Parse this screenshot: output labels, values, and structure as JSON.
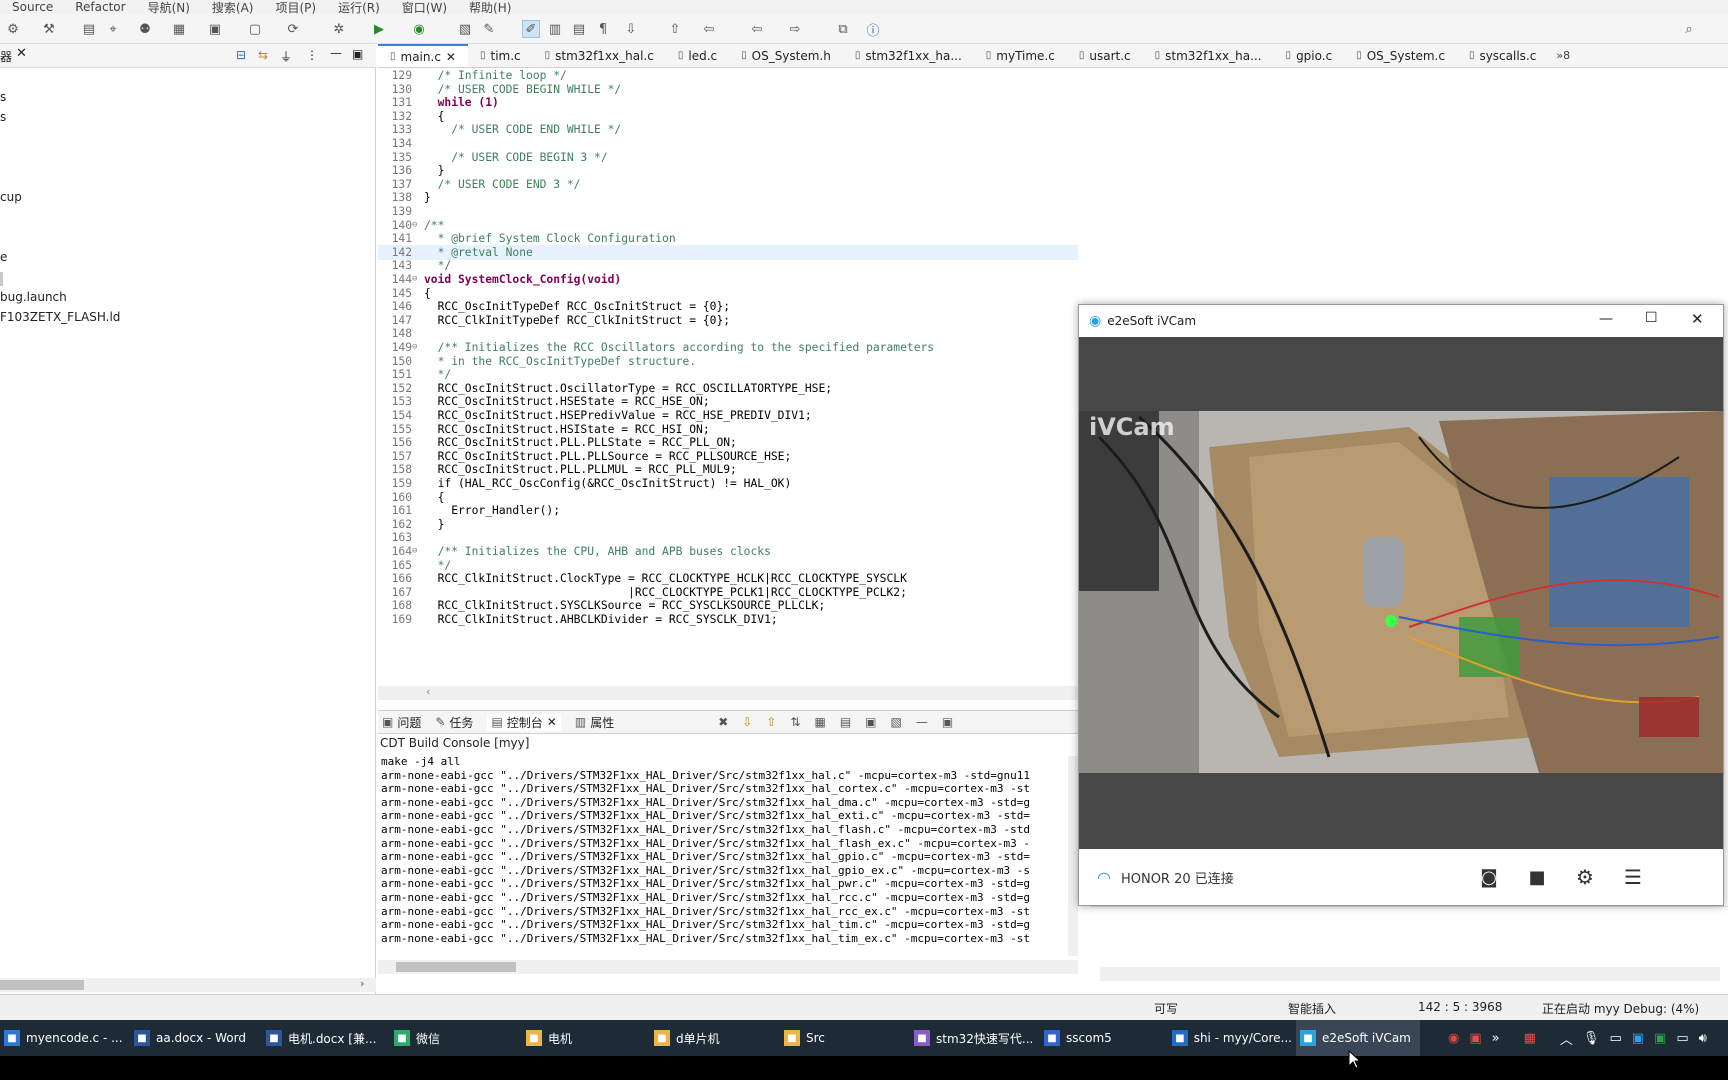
{
  "menu": [
    "Source",
    "Refactor",
    "导航(N)",
    "搜索(A)",
    "项目(P)",
    "运行(R)",
    "窗口(W)",
    "帮助(H)"
  ],
  "left_panel": {
    "tab_label": "器",
    "tree": [
      "s",
      "s",
      "cup",
      "e",
      "bug.launch",
      "F103ZETX_FLASH.ld"
    ]
  },
  "editor_tabs": [
    "main.c",
    "tim.c",
    "stm32f1xx_hal.c",
    "led.c",
    "OS_System.h",
    "stm32f1xx_ha...",
    "myTime.c",
    "usart.c",
    "stm32f1xx_ha...",
    "gpio.c",
    "OS_System.c",
    "syscalls.c"
  ],
  "editor_tabs_more": "»8",
  "code_lines": [
    {
      "n": "129",
      "f": "",
      "t": "  /* Infinite loop */",
      "c": "cmt"
    },
    {
      "n": "130",
      "f": "",
      "t": "  /* USER CODE BEGIN WHILE */",
      "c": "cmt"
    },
    {
      "n": "131",
      "f": "",
      "t": "  while (1)",
      "c": "kw"
    },
    {
      "n": "132",
      "f": "",
      "t": "  {",
      "c": ""
    },
    {
      "n": "133",
      "f": "",
      "t": "    /* USER CODE END WHILE */",
      "c": "cmt"
    },
    {
      "n": "134",
      "f": "",
      "t": "",
      "c": ""
    },
    {
      "n": "135",
      "f": "",
      "t": "    /* USER CODE BEGIN 3 */",
      "c": "cmt"
    },
    {
      "n": "136",
      "f": "",
      "t": "  }",
      "c": ""
    },
    {
      "n": "137",
      "f": "",
      "t": "  /* USER CODE END 3 */",
      "c": "cmt"
    },
    {
      "n": "138",
      "f": "",
      "t": "}",
      "c": ""
    },
    {
      "n": "139",
      "f": "",
      "t": "",
      "c": ""
    },
    {
      "n": "140",
      "f": "⊖",
      "t": "/**",
      "c": "cmt"
    },
    {
      "n": "141",
      "f": "",
      "t": "  * @brief System Clock Configuration",
      "c": "cmt"
    },
    {
      "n": "142",
      "f": "",
      "t": "  * @retval None",
      "c": "cmt"
    },
    {
      "n": "143",
      "f": "",
      "t": "  */",
      "c": "cmt"
    },
    {
      "n": "144",
      "f": "⊖",
      "t": "void SystemClock_Config(void)",
      "c": "kw"
    },
    {
      "n": "145",
      "f": "",
      "t": "{",
      "c": ""
    },
    {
      "n": "146",
      "f": "",
      "t": "  RCC_OscInitTypeDef RCC_OscInitStruct = {0};",
      "c": ""
    },
    {
      "n": "147",
      "f": "",
      "t": "  RCC_ClkInitTypeDef RCC_ClkInitStruct = {0};",
      "c": ""
    },
    {
      "n": "148",
      "f": "",
      "t": "",
      "c": ""
    },
    {
      "n": "149",
      "f": "⊖",
      "t": "  /** Initializes the RCC Oscillators according to the specified parameters",
      "c": "cmt"
    },
    {
      "n": "150",
      "f": "",
      "t": "  * in the RCC_OscInitTypeDef structure.",
      "c": "cmt"
    },
    {
      "n": "151",
      "f": "",
      "t": "  */",
      "c": "cmt"
    },
    {
      "n": "152",
      "f": "",
      "t": "  RCC_OscInitStruct.OscillatorType = RCC_OSCILLATORTYPE_HSE;",
      "c": ""
    },
    {
      "n": "153",
      "f": "",
      "t": "  RCC_OscInitStruct.HSEState = RCC_HSE_ON;",
      "c": ""
    },
    {
      "n": "154",
      "f": "",
      "t": "  RCC_OscInitStruct.HSEPredivValue = RCC_HSE_PREDIV_DIV1;",
      "c": ""
    },
    {
      "n": "155",
      "f": "",
      "t": "  RCC_OscInitStruct.HSIState = RCC_HSI_ON;",
      "c": ""
    },
    {
      "n": "156",
      "f": "",
      "t": "  RCC_OscInitStruct.PLL.PLLState = RCC_PLL_ON;",
      "c": ""
    },
    {
      "n": "157",
      "f": "",
      "t": "  RCC_OscInitStruct.PLL.PLLSource = RCC_PLLSOURCE_HSE;",
      "c": ""
    },
    {
      "n": "158",
      "f": "",
      "t": "  RCC_OscInitStruct.PLL.PLLMUL = RCC_PLL_MUL9;",
      "c": ""
    },
    {
      "n": "159",
      "f": "",
      "t": "  if (HAL_RCC_OscConfig(&RCC_OscInitStruct) != HAL_OK)",
      "c": ""
    },
    {
      "n": "160",
      "f": "",
      "t": "  {",
      "c": ""
    },
    {
      "n": "161",
      "f": "",
      "t": "    Error_Handler();",
      "c": ""
    },
    {
      "n": "162",
      "f": "",
      "t": "  }",
      "c": ""
    },
    {
      "n": "163",
      "f": "",
      "t": "",
      "c": ""
    },
    {
      "n": "164",
      "f": "⊖",
      "t": "  /** Initializes the CPU, AHB and APB buses clocks",
      "c": "cmt"
    },
    {
      "n": "165",
      "f": "",
      "t": "  */",
      "c": "cmt"
    },
    {
      "n": "166",
      "f": "",
      "t": "  RCC_ClkInitStruct.ClockType = RCC_CLOCKTYPE_HCLK|RCC_CLOCKTYPE_SYSCLK",
      "c": ""
    },
    {
      "n": "167",
      "f": "",
      "t": "                              |RCC_CLOCKTYPE_PCLK1|RCC_CLOCKTYPE_PCLK2;",
      "c": ""
    },
    {
      "n": "168",
      "f": "",
      "t": "  RCC_ClkInitStruct.SYSCLKSource = RCC_SYSCLKSOURCE_PLLCLK;",
      "c": ""
    },
    {
      "n": "169",
      "f": "",
      "t": "  RCC_ClkInitStruct.AHBCLKDivider = RCC_SYSCLK_DIV1;",
      "c": ""
    }
  ],
  "current_line": "142",
  "views_tabs": [
    "问题",
    "任务",
    "控制台",
    "属性"
  ],
  "console": {
    "title": "CDT Build Console [myy]",
    "lines": [
      "make -j4 all",
      "arm-none-eabi-gcc \"../Drivers/STM32F1xx_HAL_Driver/Src/stm32f1xx_hal.c\" -mcpu=cortex-m3 -std=gnu11",
      "arm-none-eabi-gcc \"../Drivers/STM32F1xx_HAL_Driver/Src/stm32f1xx_hal_cortex.c\" -mcpu=cortex-m3 -st",
      "arm-none-eabi-gcc \"../Drivers/STM32F1xx_HAL_Driver/Src/stm32f1xx_hal_dma.c\" -mcpu=cortex-m3 -std=g",
      "arm-none-eabi-gcc \"../Drivers/STM32F1xx_HAL_Driver/Src/stm32f1xx_hal_exti.c\" -mcpu=cortex-m3 -std=",
      "arm-none-eabi-gcc \"../Drivers/STM32F1xx_HAL_Driver/Src/stm32f1xx_hal_flash.c\" -mcpu=cortex-m3 -std",
      "arm-none-eabi-gcc \"../Drivers/STM32F1xx_HAL_Driver/Src/stm32f1xx_hal_flash_ex.c\" -mcpu=cortex-m3 -",
      "arm-none-eabi-gcc \"../Drivers/STM32F1xx_HAL_Driver/Src/stm32f1xx_hal_gpio.c\" -mcpu=cortex-m3 -std=",
      "arm-none-eabi-gcc \"../Drivers/STM32F1xx_HAL_Driver/Src/stm32f1xx_hal_gpio_ex.c\" -mcpu=cortex-m3 -s",
      "arm-none-eabi-gcc \"../Drivers/STM32F1xx_HAL_Driver/Src/stm32f1xx_hal_pwr.c\" -mcpu=cortex-m3 -std=g",
      "arm-none-eabi-gcc \"../Drivers/STM32F1xx_HAL_Driver/Src/stm32f1xx_hal_rcc.c\" -mcpu=cortex-m3 -std=g",
      "arm-none-eabi-gcc \"../Drivers/STM32F1xx_HAL_Driver/Src/stm32f1xx_hal_rcc_ex.c\" -mcpu=cortex-m3 -st",
      "arm-none-eabi-gcc \"../Drivers/STM32F1xx_HAL_Driver/Src/stm32f1xx_hal_tim.c\" -mcpu=cortex-m3 -std=g",
      "arm-none-eabi-gcc \"../Drivers/STM32F1xx_HAL_Driver/Src/stm32f1xx_hal_tim_ex.c\" -mcpu=cortex-m3 -st"
    ]
  },
  "status": {
    "writable": "可写",
    "insert_mode": "智能插入",
    "position": "142 : 5 : 3968",
    "progress": "正在启动 myy Debug: (4%)"
  },
  "ivcam": {
    "title": "e2eSoft iVCam",
    "watermark": "iVCam",
    "device_status": "HONOR 20 已连接"
  },
  "taskbar": [
    {
      "label": "myencode.c - ...",
      "icon": "vscode-icon",
      "color": "#2b7bd6"
    },
    {
      "label": "aa.docx - Word",
      "icon": "word-icon",
      "color": "#2b579a"
    },
    {
      "label": "电机.docx [兼...",
      "icon": "word-icon",
      "color": "#2b579a"
    },
    {
      "label": "微信",
      "icon": "wechat-icon",
      "color": "#2aae67"
    },
    {
      "label": "电机",
      "icon": "folder-icon",
      "color": "#e8b64a"
    },
    {
      "label": "d单片机",
      "icon": "folder-icon",
      "color": "#e8b64a"
    },
    {
      "label": "Src",
      "icon": "folder-icon",
      "color": "#e8b64a"
    },
    {
      "label": "stm32快速写代...",
      "icon": "visual-studio-icon",
      "color": "#8a5cc7"
    },
    {
      "label": "sscom5",
      "icon": "sscom-icon",
      "color": "#3366cc"
    },
    {
      "label": "shi - myy/Core...",
      "icon": "ide-icon",
      "color": "#1f6ec7"
    },
    {
      "label": "e2eSoft iVCam",
      "icon": "ivcam-icon",
      "color": "#2aa3e0"
    }
  ]
}
